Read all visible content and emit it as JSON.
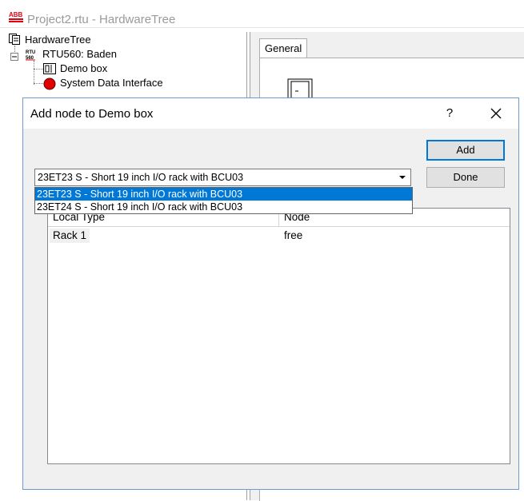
{
  "main_window": {
    "title": "Project2.rtu - HardwareTree",
    "logo_text": "ABB"
  },
  "tree": {
    "items": [
      {
        "label": "HardwareTree",
        "icon": "hardware-tree-icon"
      },
      {
        "label": "RTU560: Baden",
        "icon": "rtu-icon",
        "icon_text": "RTU 560"
      },
      {
        "label": "Demo box",
        "icon": "rack-icon"
      },
      {
        "label": "System Data Interface",
        "icon": "red-circle-icon"
      }
    ]
  },
  "right_panel": {
    "tabs": [
      {
        "label": "General"
      }
    ]
  },
  "dialog": {
    "title": "Add node to Demo box",
    "help_label": "?",
    "add_label": "Add",
    "done_label": "Done",
    "combo": {
      "selected": "23ET23 S - Short 19 inch I/O rack with BCU03",
      "options": [
        {
          "label": "23ET23 S - Short 19 inch I/O rack with BCU03",
          "selected": true
        },
        {
          "label": "23ET24 S - Short 19 inch I/O rack with BCU03",
          "selected": false
        }
      ]
    },
    "list": {
      "columns": [
        "Local Type",
        "Node"
      ],
      "rows": [
        {
          "local_type": "Rack 1",
          "node": "free"
        }
      ]
    }
  },
  "colors": {
    "selection": "#0078d7",
    "dialog_border": "#6b9bd1",
    "title_gray": "#9a9a9a"
  }
}
